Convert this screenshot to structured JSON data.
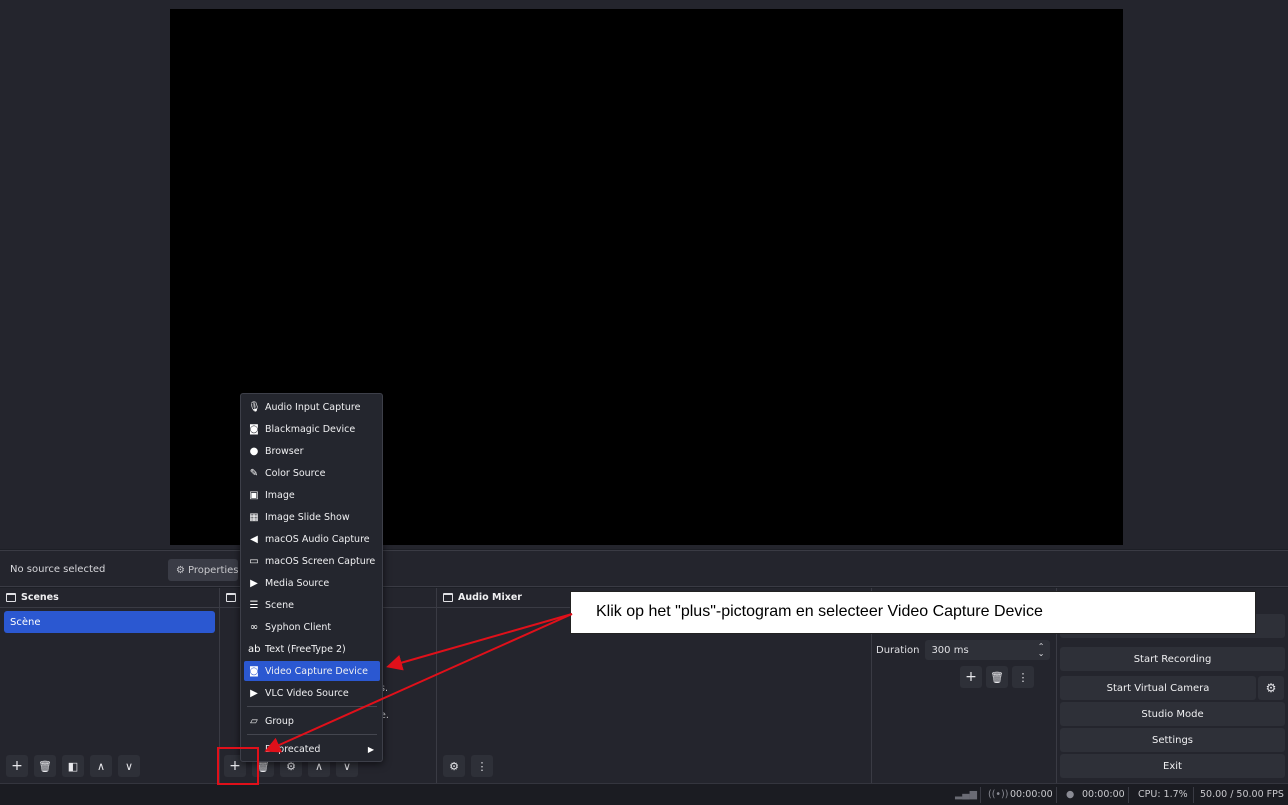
{
  "context_bar": {
    "no_source": "No source selected",
    "properties_label": "Properties"
  },
  "docks": {
    "scenes": {
      "title": "Scenes",
      "items": [
        "Scène"
      ]
    },
    "sources": {
      "title": "",
      "hint_line1": "s.",
      "hint_line2": "e."
    },
    "audio_mixer": {
      "title": "Audio Mixer"
    },
    "transitions": {
      "duration_label": "Duration",
      "duration_value": "300 ms"
    },
    "controls": {
      "start_recording": "Start Recording",
      "start_virtual_camera": "Start Virtual Camera",
      "studio_mode": "Studio Mode",
      "settings": "Settings",
      "exit": "Exit"
    }
  },
  "add_source_menu": {
    "items": [
      {
        "label": "Audio Input Capture",
        "icon": "microphone-icon",
        "glyph": "🎙"
      },
      {
        "label": "Blackmagic Device",
        "icon": "camera-icon",
        "glyph": "◙"
      },
      {
        "label": "Browser",
        "icon": "globe-icon",
        "glyph": "●"
      },
      {
        "label": "Color Source",
        "icon": "paintbrush-icon",
        "glyph": "✎"
      },
      {
        "label": "Image",
        "icon": "image-icon",
        "glyph": "▣"
      },
      {
        "label": "Image Slide Show",
        "icon": "slideshow-icon",
        "glyph": "▦"
      },
      {
        "label": "macOS Audio Capture",
        "icon": "speaker-icon",
        "glyph": "◀"
      },
      {
        "label": "macOS Screen Capture",
        "icon": "monitor-icon",
        "glyph": "▭"
      },
      {
        "label": "Media Source",
        "icon": "play-icon",
        "glyph": "▶"
      },
      {
        "label": "Scene",
        "icon": "list-icon",
        "glyph": "☰"
      },
      {
        "label": "Syphon Client",
        "icon": "link-icon",
        "glyph": "∞"
      },
      {
        "label": "Text (FreeType 2)",
        "icon": "text-icon",
        "glyph": "ab"
      },
      {
        "label": "Video Capture Device",
        "icon": "camera-icon",
        "glyph": "◙"
      },
      {
        "label": "VLC Video Source",
        "icon": "play-icon",
        "glyph": "▶"
      }
    ],
    "group_label": "Group",
    "deprecated_label": "Deprecated"
  },
  "status_bar": {
    "stream_time": "00:00:00",
    "record_time": "00:00:00",
    "cpu": "CPU: 1.7%",
    "fps": "50.00 / 50.00 FPS"
  },
  "annotation": {
    "callout_text": "Klik op het \"plus\"-pictogram en selecteer Video Capture Device"
  },
  "colors": {
    "accent": "#2b58d1",
    "annotation_red": "#e0101a",
    "background": "#1d1f26"
  }
}
